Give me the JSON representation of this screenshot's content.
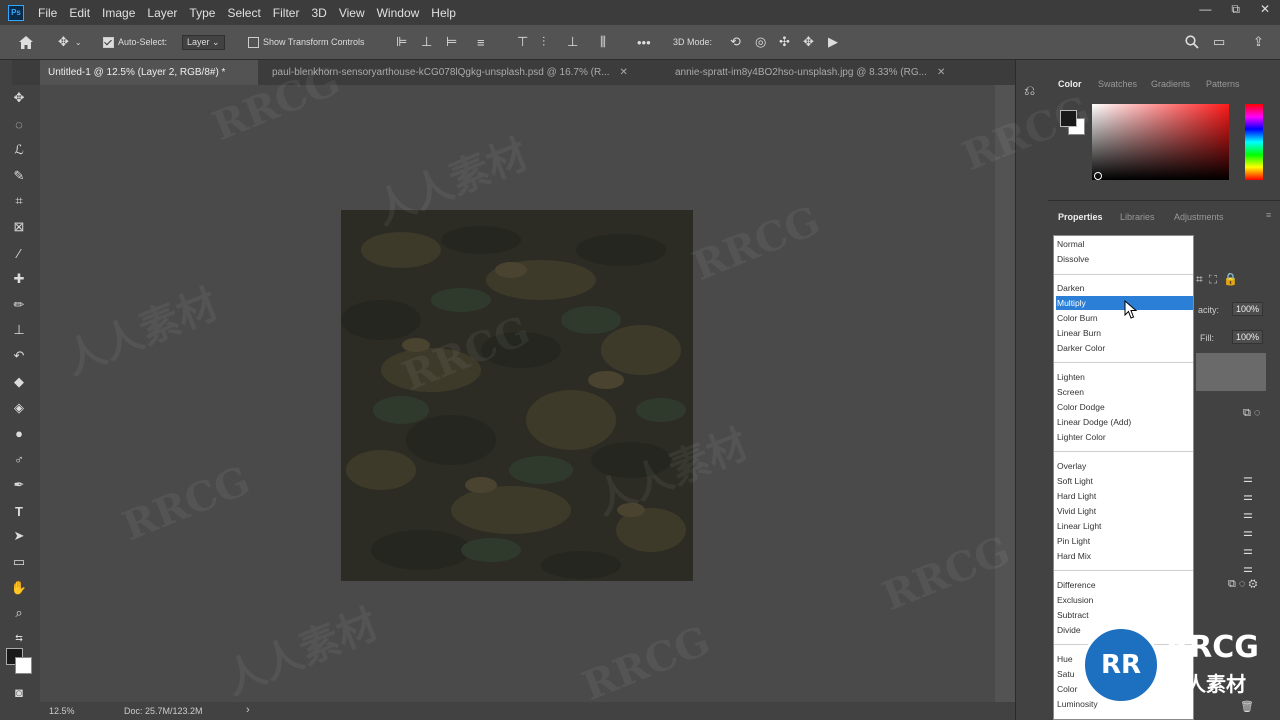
{
  "app": {
    "logo": "Ps"
  },
  "menu": [
    "File",
    "Edit",
    "Image",
    "Layer",
    "Type",
    "Select",
    "Filter",
    "3D",
    "View",
    "Window",
    "Help"
  ],
  "window_controls": {
    "minimize": "—",
    "restore": "⧉",
    "close": "✕"
  },
  "options_bar": {
    "auto_select_label": "Auto-Select:",
    "auto_select_value": "Layer",
    "show_transform_label": "Show Transform Controls",
    "mode_3d_label": "3D Mode:",
    "more_label": "•••"
  },
  "tabs": [
    {
      "label": "Untitled-1 @ 12.5% (Layer 2, RGB/8#) *",
      "active": true
    },
    {
      "label": "paul-blenkhorn-sensoryarthouse-kCG078lQgkg-unsplash.psd @ 16.7% (R...",
      "active": false
    },
    {
      "label": "annie-spratt-im8y4BO2hso-unsplash.jpg @ 8.33% (RG...",
      "active": false
    }
  ],
  "status": {
    "zoom": "12.5%",
    "doc": "Doc: 25.7M/123.2M"
  },
  "color_panel": {
    "tabs": [
      "Color",
      "Swatches",
      "Gradients",
      "Patterns"
    ],
    "active": "Color"
  },
  "properties_panel": {
    "tabs": [
      "Properties",
      "Libraries",
      "Adjustments"
    ],
    "active": "Properties",
    "opacity_label": "acity:",
    "opacity_value": "100%",
    "fill_label": "Fill:",
    "fill_value": "100%"
  },
  "blend_modes": {
    "selected": "Multiply",
    "groups": [
      [
        "Normal",
        "Dissolve"
      ],
      [
        "Darken",
        "Multiply",
        "Color Burn",
        "Linear Burn",
        "Darker Color"
      ],
      [
        "Lighten",
        "Screen",
        "Color Dodge",
        "Linear Dodge (Add)",
        "Lighter Color"
      ],
      [
        "Overlay",
        "Soft Light",
        "Hard Light",
        "Vivid Light",
        "Linear Light",
        "Pin Light",
        "Hard Mix"
      ],
      [
        "Difference",
        "Exclusion",
        "Subtract",
        "Divide"
      ],
      [
        "Hue",
        "Satu",
        "Color",
        "Luminosity"
      ]
    ]
  },
  "watermark": {
    "brand": "RRCG",
    "cn": "人人素材"
  },
  "colors": {
    "accent": "#2b7fd6",
    "menubar": "#3c3c3c",
    "panel": "#424242",
    "canvas": "#4a4a4a"
  }
}
